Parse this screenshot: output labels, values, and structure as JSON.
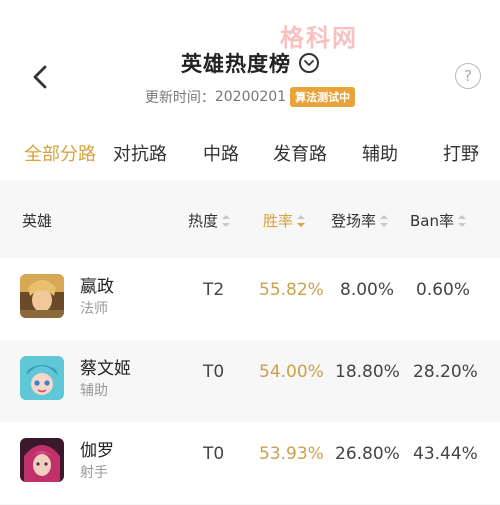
{
  "watermark": "格科网",
  "header": {
    "title": "英雄热度榜",
    "update_label": "更新时间：",
    "update_value": "20200201",
    "badge": "算法测试中",
    "help": "?"
  },
  "tabs": [
    {
      "label": "全部分路",
      "active": true
    },
    {
      "label": "对抗路",
      "active": false
    },
    {
      "label": "中路",
      "active": false
    },
    {
      "label": "发育路",
      "active": false
    },
    {
      "label": "辅助",
      "active": false
    },
    {
      "label": "打野",
      "active": false
    }
  ],
  "columns": {
    "hero": "英雄",
    "heat": "热度",
    "win_rate": "胜率",
    "pick_rate": "登场率",
    "ban_rate": "Ban率"
  },
  "rows": [
    {
      "name": "嬴政",
      "role": "法师",
      "tier": "T2",
      "win_rate": "55.82%",
      "pick_rate": "8.00%",
      "ban_rate": "0.60%",
      "avatar_icon": "hero-portrait-icon"
    },
    {
      "name": "蔡文姬",
      "role": "辅助",
      "tier": "T0",
      "win_rate": "54.00%",
      "pick_rate": "18.80%",
      "ban_rate": "28.20%",
      "avatar_icon": "hero-portrait-icon"
    },
    {
      "name": "伽罗",
      "role": "射手",
      "tier": "T0",
      "win_rate": "53.93%",
      "pick_rate": "26.80%",
      "ban_rate": "43.44%",
      "avatar_icon": "hero-portrait-icon"
    }
  ],
  "colors": {
    "accent": "#d7a240",
    "badge": "#e8a33a",
    "win_rate": "#caa04b"
  }
}
